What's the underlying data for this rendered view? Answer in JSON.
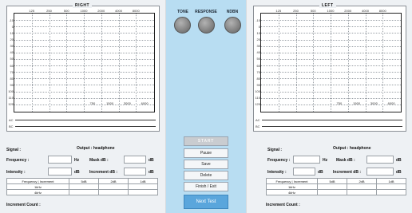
{
  "right_panel": {
    "title": "RIGHT",
    "freq_top_ticks": [
      "125",
      "250",
      "500",
      "1000",
      "2000",
      "4000",
      "8000"
    ],
    "freq_bottom_ticks": [
      "750",
      "1500",
      "3000",
      "6000"
    ],
    "db_ticks": [
      "-10",
      "0",
      "10",
      "20",
      "30",
      "40",
      "50",
      "60",
      "70",
      "80",
      "90",
      "100",
      "110",
      "120"
    ],
    "ac_label": "AC",
    "bc_label": "BC",
    "signal_label": "Signal :",
    "output_label": "Output : headphone",
    "frequency_label": "Frequency :",
    "frequency_unit": "Hz",
    "mask_label": "Mask dB :",
    "mask_unit": "dB",
    "intensity_label": "Intensity :",
    "intensity_unit": "dB",
    "increment_label": "Increment dB :",
    "increment_unit": "dB",
    "table_headers": [
      "Frequency | Increment",
      "5dB",
      "2dB",
      "1dB"
    ],
    "table_rows": [
      "1kHz",
      "4kHz"
    ],
    "increment_count_label": "Increment Count :"
  },
  "left_panel": {
    "title": "LEFT",
    "freq_top_ticks": [
      "125",
      "250",
      "500",
      "1000",
      "2000",
      "4000",
      "8000"
    ],
    "freq_bottom_ticks": [
      "750",
      "1500",
      "3000",
      "6000"
    ],
    "db_ticks": [
      "-10",
      "0",
      "10",
      "20",
      "30",
      "40",
      "50",
      "60",
      "70",
      "80",
      "90",
      "100",
      "110",
      "120"
    ],
    "ac_label": "AC",
    "bc_label": "BC",
    "signal_label": "Signal :",
    "output_label": "Output : headphone",
    "frequency_label": "Frequency :",
    "frequency_unit": "Hz",
    "mask_label": "Mask dB :",
    "mask_unit": "dB",
    "intensity_label": "Intensity :",
    "intensity_unit": "dB",
    "increment_label": "Increment dB :",
    "increment_unit": "dB",
    "table_headers": [
      "Frequency | Increment",
      "5dB",
      "2dB",
      "1dB"
    ],
    "table_rows": [
      "1kHz",
      "4kHz"
    ],
    "increment_count_label": "Increment Count :"
  },
  "middle": {
    "tone_label": "TONE",
    "response_label": "RESPONSE",
    "ndbn_label": "NDBN",
    "indicator_color": "#7a7a7a",
    "buttons": {
      "start": "START",
      "pause": "Pause",
      "save": "Save",
      "delete": "Delete",
      "finish": "Finish / Exit",
      "next": "Next Test"
    }
  },
  "colors": {
    "side_bg": "#eef1f4",
    "middle_bg": "#b8ddf2",
    "next_button": "#5aa6dc"
  }
}
